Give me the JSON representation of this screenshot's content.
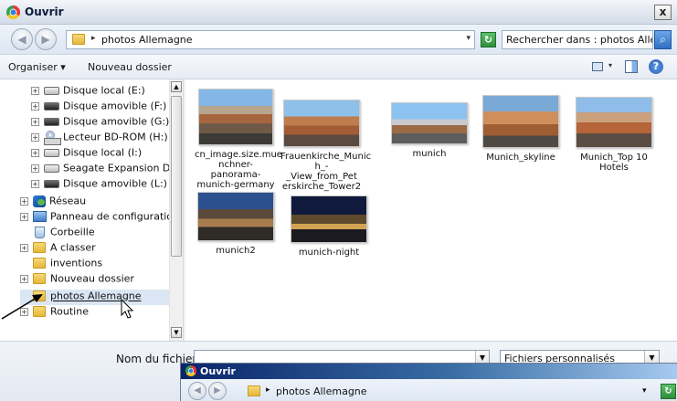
{
  "window": {
    "title": "Ouvrir",
    "close_glyph": "x"
  },
  "address": {
    "back_glyph": "◀",
    "forward_glyph": "▶",
    "crumb_arrow": "▸",
    "path": "photos Allemagne",
    "dropdown_glyph": "▾",
    "refresh_glyph": "↻",
    "search_placeholder": "Rechercher dans : photos Alle...",
    "search_glyph": "⌕"
  },
  "toolbar": {
    "organize": "Organiser ▾",
    "new_folder": "Nouveau dossier",
    "views_glyph": "▾",
    "help_glyph": "?"
  },
  "nav_tree": [
    {
      "label": "Disque local (E:)",
      "icon": "drive-icon",
      "expand": "+"
    },
    {
      "label": "Disque amovible (F:)",
      "icon": "removable-drive-icon",
      "expand": "+"
    },
    {
      "label": "Disque amovible (G:)",
      "icon": "removable-drive-icon",
      "expand": "+"
    },
    {
      "label": "Lecteur BD-ROM (H:)",
      "icon": "bd-rom-icon",
      "expand": "+"
    },
    {
      "label": "Disque local (I:)",
      "icon": "drive-icon",
      "expand": "+"
    },
    {
      "label": "Seagate Expansion Drive (",
      "icon": "drive-icon",
      "expand": "+"
    },
    {
      "label": "Disque amovible (L:)",
      "icon": "removable-drive-icon",
      "expand": "+"
    },
    {
      "label": "Réseau",
      "icon": "network-icon",
      "expand": "+"
    },
    {
      "label": "Panneau de configuration",
      "icon": "control-panel-icon",
      "expand": "+"
    },
    {
      "label": "Corbeille",
      "icon": "recycle-bin-icon",
      "expand": ""
    },
    {
      "label": "A classer",
      "icon": "folder-icon",
      "expand": "+"
    },
    {
      "label": "inventions",
      "icon": "folder-icon",
      "expand": ""
    },
    {
      "label": "Nouveau dossier",
      "icon": "folder-icon",
      "expand": "+"
    },
    {
      "label": "photos Allemagne",
      "icon": "folder-icon",
      "expand": "",
      "selected": true
    },
    {
      "label": "Routine",
      "icon": "folder-icon",
      "expand": "+"
    }
  ],
  "scroll": {
    "up_glyph": "▲",
    "down_glyph": "▼"
  },
  "files": [
    {
      "name": "cn_image.size.mue nchner-panorama-munich-germany",
      "thumb": "panorama"
    },
    {
      "name": "Frauenkirche_Munic h_-_View_from_Pet erskirche_Tower2",
      "thumb": "frauen"
    },
    {
      "name": "munich",
      "thumb": "munich"
    },
    {
      "name": "Munich_skyline",
      "thumb": "skyline"
    },
    {
      "name": "Munich_Top 10 Hotels",
      "thumb": "top10"
    },
    {
      "name": "munich2",
      "thumb": "munich2"
    },
    {
      "name": "munich-night",
      "thumb": "night"
    }
  ],
  "bottom": {
    "filename_label": "Nom du fichier :",
    "filename_value": "",
    "filetype": "Fichiers personnalisés",
    "dropdown_glyph": "▼"
  },
  "second_window": {
    "title": "Ouvrir",
    "path": "photos Allemagne",
    "crumb_arrow": "▸",
    "back_glyph": "◀",
    "forward_glyph": "▶",
    "dropdown_glyph": "▾",
    "refresh_glyph": "↻"
  }
}
